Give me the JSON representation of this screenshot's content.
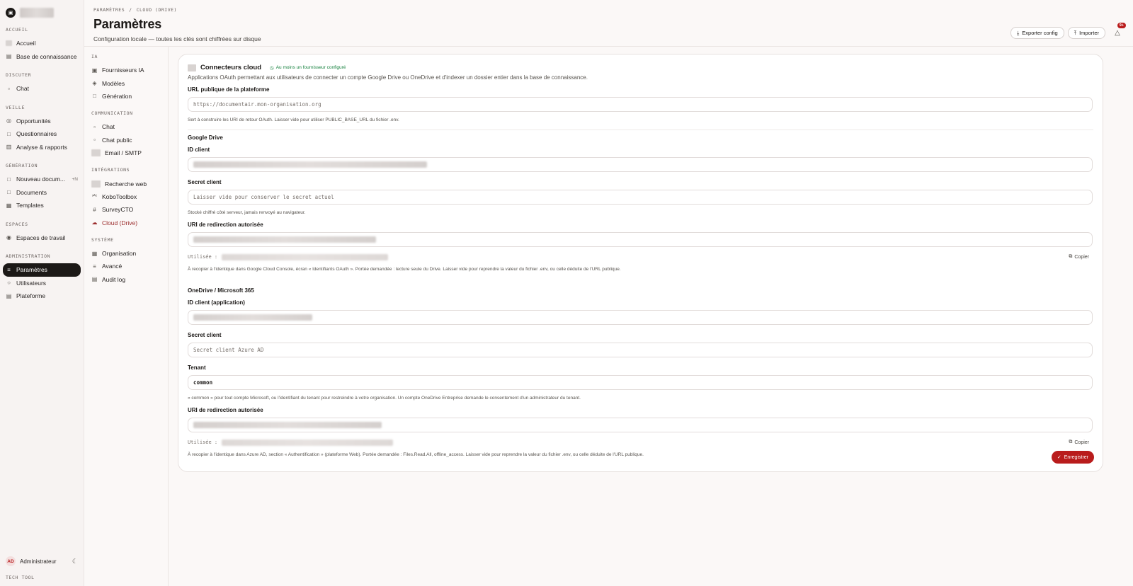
{
  "sidebar": {
    "brand_icon": "document-icon",
    "sections": [
      {
        "head": "ACCUEIL",
        "items": [
          {
            "label": "Accueil",
            "icon": "blurred"
          },
          {
            "label": "Base de connaissance",
            "icon": "book-icon"
          }
        ]
      },
      {
        "head": "DISCUTER",
        "items": [
          {
            "label": "Chat",
            "icon": "chat-icon"
          }
        ]
      },
      {
        "head": "VEILLE",
        "items": [
          {
            "label": "Opportunités",
            "icon": "target-icon"
          },
          {
            "label": "Questionnaires",
            "icon": "file-icon"
          },
          {
            "label": "Analyse & rapports",
            "icon": "chart-icon"
          }
        ]
      },
      {
        "head": "GÉNÉRATION",
        "items": [
          {
            "label": "Nouveau docum...",
            "icon": "file-plus-icon",
            "badge": "+N"
          },
          {
            "label": "Documents",
            "icon": "file-icon"
          },
          {
            "label": "Templates",
            "icon": "grid-icon"
          }
        ]
      },
      {
        "head": "ESPACES",
        "items": [
          {
            "label": "Espaces de travail",
            "icon": "users-icon"
          }
        ]
      },
      {
        "head": "ADMINISTRATION",
        "items": [
          {
            "label": "Paramètres",
            "icon": "sliders-icon",
            "active": true
          },
          {
            "label": "Utilisateurs",
            "icon": "user-icon"
          },
          {
            "label": "Plateforme",
            "icon": "server-icon"
          }
        ]
      }
    ],
    "user": {
      "initials": "AD",
      "name": "Administrateur"
    },
    "footer_tag": "TECH TOOL"
  },
  "header": {
    "crumbs": [
      "PARAMÈTRES",
      "/",
      "CLOUD (DRIVE)"
    ],
    "title": "Paramètres",
    "subtitle": "Configuration locale — toutes les clés sont chiffrées sur disque",
    "export_label": "Exporter config",
    "import_label": "Importer",
    "notif_count": "9+"
  },
  "subnav": {
    "sections": [
      {
        "head": "IA",
        "items": [
          {
            "label": "Fournisseurs IA",
            "icon": "cpu-icon"
          },
          {
            "label": "Modèles",
            "icon": "cubes-icon"
          },
          {
            "label": "Génération",
            "icon": "file-icon"
          }
        ]
      },
      {
        "head": "COMMUNICATION",
        "items": [
          {
            "label": "Chat",
            "icon": "chat-icon"
          },
          {
            "label": "Chat public",
            "icon": "chat-icon"
          },
          {
            "label": "Email / SMTP",
            "icon": "blurred"
          }
        ]
      },
      {
        "head": "INTÉGRATIONS",
        "items": [
          {
            "label": "Recherche web",
            "icon": "blurred"
          },
          {
            "label": "KoboToolbox",
            "icon": "plug-icon"
          },
          {
            "label": "SurveyCTO",
            "icon": "hash-icon"
          },
          {
            "label": "Cloud (Drive)",
            "icon": "cloud-icon",
            "active": true
          }
        ]
      },
      {
        "head": "SYSTÈME",
        "items": [
          {
            "label": "Organisation",
            "icon": "building-icon"
          },
          {
            "label": "Avancé",
            "icon": "sliders-icon"
          },
          {
            "label": "Audit log",
            "icon": "log-icon"
          }
        ]
      }
    ]
  },
  "card": {
    "title": "Connecteurs cloud",
    "status": "Au moins un fournisseur configuré",
    "description": "Applications OAuth permettant aux utilisateurs de connecter un compte Google Drive ou OneDrive et d'indexer un dossier entier dans la base de connaissance.",
    "public_url_label": "URL publique de la plateforme",
    "public_url_placeholder": "https://documentair.mon-organisation.org",
    "public_url_hint": "Sert à construire les URI de retour OAuth. Laisser vide pour utiliser PUBLIC_BASE_URL du fichier .env.",
    "google": {
      "title": "Google Drive",
      "client_id_label": "ID client",
      "secret_label": "Secret client",
      "secret_placeholder": "Laisser vide pour conserver le secret actuel",
      "secret_hint": "Stocké chiffré côté serveur, jamais renvoyé au navigateur.",
      "redirect_label": "URI de redirection autorisée",
      "used_label": "Utilisée :",
      "copy_label": "Copier",
      "redirect_hint": "À recopier à l'identique dans Google Cloud Console, écran « Identifiants OAuth ». Portée demandée : lecture seule du Drive. Laisser vide pour reprendre la valeur du fichier .env, ou celle déduite de l'URL publique."
    },
    "onedrive": {
      "title": "OneDrive / Microsoft 365",
      "client_id_label": "ID client (application)",
      "secret_label": "Secret client",
      "secret_placeholder": "Secret client Azure AD",
      "tenant_label": "Tenant",
      "tenant_value": "common",
      "tenant_hint": "« common » pour tout compte Microsoft, ou l'identifiant du tenant pour restreindre à votre organisation. Un compte OneDrive Entreprise demande le consentement d'un administrateur du tenant.",
      "redirect_label": "URI de redirection autorisée",
      "used_label": "Utilisée :",
      "copy_label": "Copier",
      "redirect_hint": "À recopier à l'identique dans Azure AD, section « Authentification » (plateforme Web). Portée demandée : Files.Read.All, offline_access. Laisser vide pour reprendre la valeur du fichier .env, ou celle déduite de l'URL publique."
    },
    "save_label": "Enregistrer"
  },
  "colors": {
    "accent": "#b91c1c",
    "active_nav": "#1c1917",
    "status_ok": "#15803d"
  }
}
